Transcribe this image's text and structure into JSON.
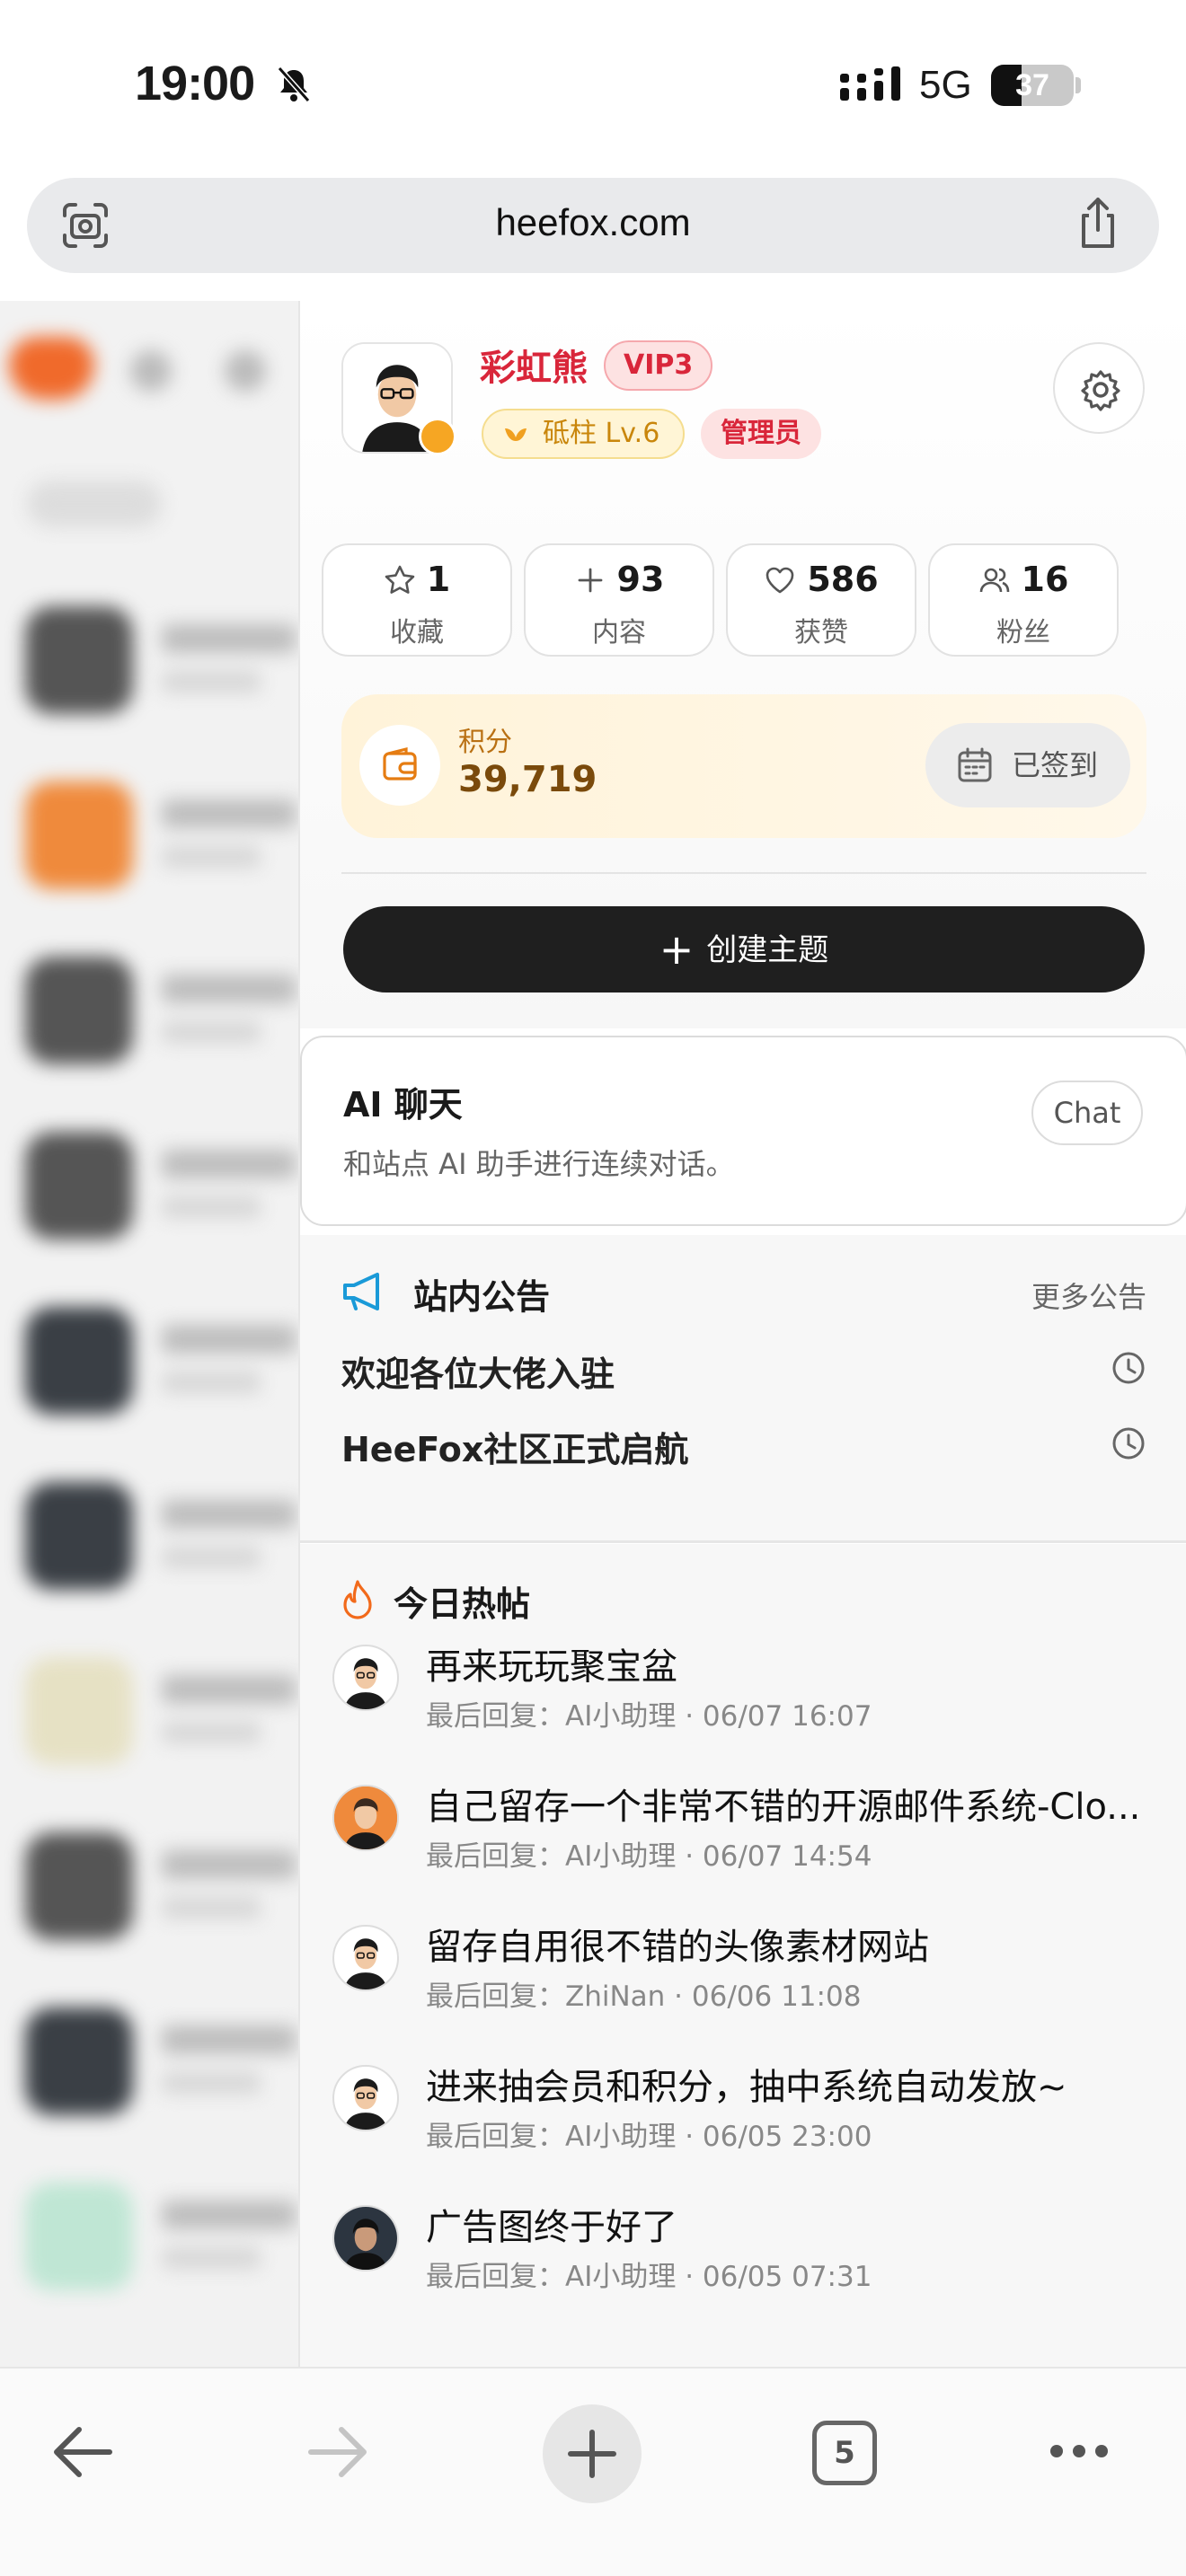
{
  "status": {
    "time": "19:00",
    "network": "5G",
    "battery": "37",
    "battery_level": 0.37
  },
  "browser": {
    "url": "heefox.com",
    "tab_count": "5"
  },
  "profile": {
    "name": "彩虹熊",
    "vip": "VIP3",
    "level": "砥柱 Lv.6",
    "role": "管理员",
    "stats": [
      {
        "value": "1",
        "label": "收藏",
        "icon": "star-icon"
      },
      {
        "value": "93",
        "label": "内容",
        "icon": "plus-icon"
      },
      {
        "value": "586",
        "label": "获赞",
        "icon": "heart-icon"
      },
      {
        "value": "16",
        "label": "粉丝",
        "icon": "users-icon"
      }
    ],
    "points_label": "积分",
    "points_value": "39,719",
    "checkin_label": "已签到",
    "create_label": "创建主题"
  },
  "ai_chat": {
    "title": "AI 聊天",
    "description": "和站点 AI 助手进行连续对话。",
    "button": "Chat"
  },
  "announcements": {
    "title": "站内公告",
    "more": "更多公告",
    "items": [
      "欢迎各位大佬入驻",
      "HeeFox社区正式启航"
    ]
  },
  "hot_posts": {
    "title": "今日热帖",
    "items": [
      {
        "title": "再来玩玩聚宝盆",
        "meta": "最后回复：AI小助理 · 06/07 16:07",
        "avatar": "dev"
      },
      {
        "title": "自己留存一个非常不错的开源邮件系统-Clo...",
        "meta": "最后回复：AI小助理 · 06/07 14:54",
        "avatar": "orange"
      },
      {
        "title": "留存自用很不错的头像素材网站",
        "meta": "最后回复：ZhiNan · 06/06 11:08",
        "avatar": "dev"
      },
      {
        "title": "进来抽会员和积分，抽中系统自动发放~",
        "meta": "最后回复：AI小助理 · 06/05 23:00",
        "avatar": "dev"
      },
      {
        "title": "广告图终于好了",
        "meta": "最后回复：AI小助理 · 06/05 07:31",
        "avatar": "photo"
      }
    ]
  },
  "colors": {
    "accent": "#d9263a",
    "gold": "#c9860b",
    "dark_button": "#1f1f1f"
  }
}
